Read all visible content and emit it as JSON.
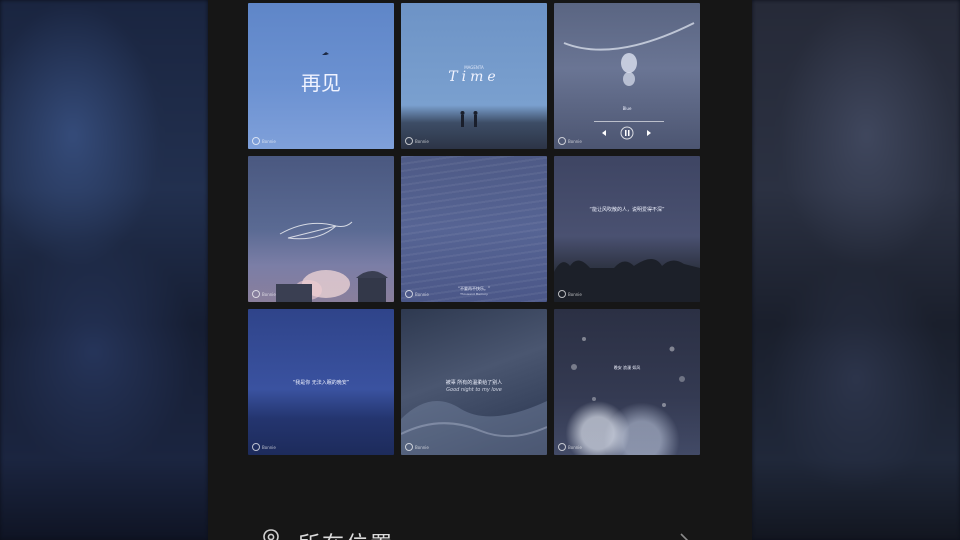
{
  "tiles": [
    {
      "id": "t1",
      "caption": "再见",
      "watermark": "Bonnie"
    },
    {
      "id": "t2",
      "caption": "Time",
      "small": "MAGENTA",
      "watermark": "Bonnie"
    },
    {
      "id": "t3",
      "caption": "Blue",
      "watermark": "Bonnie"
    },
    {
      "id": "t4",
      "caption": "",
      "watermark": "Bonnie"
    },
    {
      "id": "t5",
      "caption": "“不要再不快乐。”",
      "small": "Thousand Memory",
      "watermark": "Bonnie"
    },
    {
      "id": "t6",
      "caption": "“能让风吹散的人，说明爱得不深”",
      "watermark": "Bonnie"
    },
    {
      "id": "t7",
      "caption": "“我是你 无法入眠的晚安”",
      "watermark": "Bonnie"
    },
    {
      "id": "t8",
      "caption": "被辜 所有的温柔给了别人",
      "small": "Good night to my love",
      "watermark": "Bonnie"
    },
    {
      "id": "t9",
      "caption": "晚安 浪漫 如风",
      "watermark": "Bonnie"
    }
  ],
  "location": {
    "label": "所在位置",
    "icon": "location-pin-icon",
    "arrow": "chevron-right-icon"
  }
}
